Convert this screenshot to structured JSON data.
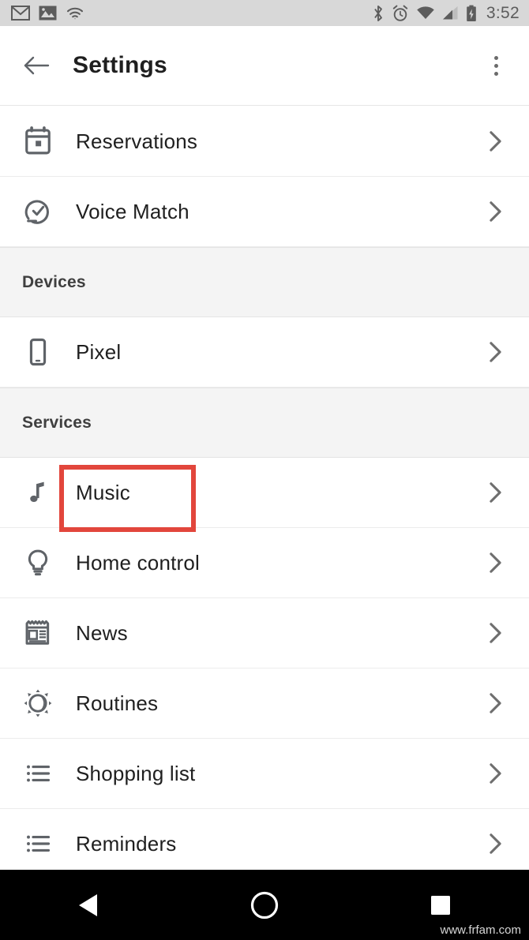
{
  "status_bar": {
    "icons_left": [
      "gmail-icon",
      "photos-icon",
      "wifi-icon"
    ],
    "icons_right": [
      "bluetooth-icon",
      "alarm-icon",
      "wifi-signal-icon",
      "cell-signal-icon",
      "battery-charging-icon"
    ],
    "time": "3:52",
    "background_color": "#d8d8d8"
  },
  "app_bar": {
    "back_icon": "back-arrow-icon",
    "title": "Settings",
    "overflow_icon": "more-vert-icon"
  },
  "list": [
    {
      "type": "item",
      "icon": "calendar-icon",
      "label": "Reservations",
      "chevron": "chevron-right-icon"
    },
    {
      "type": "item",
      "icon": "voice-match-icon",
      "label": "Voice Match",
      "chevron": "chevron-right-icon"
    },
    {
      "type": "header",
      "label": "Devices"
    },
    {
      "type": "item",
      "icon": "phone-icon",
      "label": "Pixel",
      "chevron": "chevron-right-icon"
    },
    {
      "type": "header",
      "label": "Services"
    },
    {
      "type": "item",
      "icon": "music-note-icon",
      "label": "Music",
      "chevron": "chevron-right-icon"
    },
    {
      "type": "item",
      "icon": "lightbulb-icon",
      "label": "Home control",
      "chevron": "chevron-right-icon"
    },
    {
      "type": "item",
      "icon": "news-icon",
      "label": "News",
      "chevron": "chevron-right-icon"
    },
    {
      "type": "item",
      "icon": "routines-icon",
      "label": "Routines",
      "chevron": "chevron-right-icon"
    },
    {
      "type": "item",
      "icon": "list-icon",
      "label": "Shopping list",
      "chevron": "chevron-right-icon"
    },
    {
      "type": "item",
      "icon": "list-icon",
      "label": "Reminders",
      "chevron": "chevron-right-icon"
    }
  ],
  "annotation": {
    "target_label": "Music",
    "color": "#e2463c"
  },
  "nav_bar": {
    "back_icon": "nav-back-triangle-icon",
    "home_icon": "nav-home-circle-icon",
    "recents_icon": "nav-recents-square-icon",
    "background_color": "#000000"
  },
  "watermark": "www.frfam.com"
}
